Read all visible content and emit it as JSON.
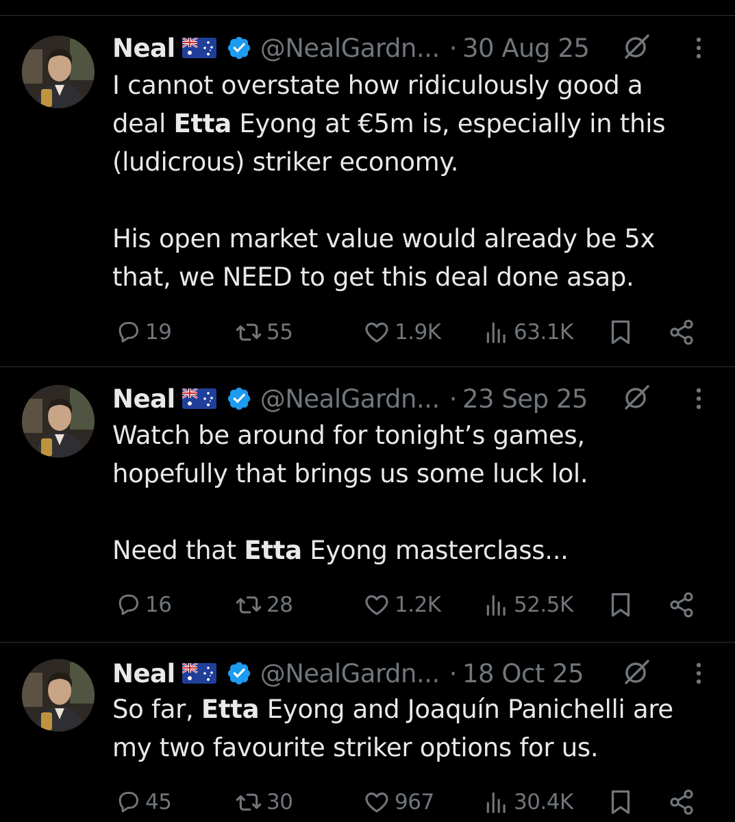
{
  "tweets": [
    {
      "name": "Neal",
      "handle": "@NealGardn...",
      "dot": "·",
      "date": "30 Aug 25",
      "body": [
        [
          {
            "t": "I cannot overstate how ridiculously good a"
          }
        ],
        [
          {
            "t": "deal "
          },
          {
            "t": "Etta",
            "b": true
          },
          {
            "t": " Eyong at €5m is, especially in this"
          }
        ],
        [
          {
            "t": "(ludicrous) striker economy."
          }
        ],
        [],
        [
          {
            "t": "His open market value would already be 5x"
          }
        ],
        [
          {
            "t": "that, we NEED to get this deal done asap."
          }
        ]
      ],
      "replies": "19",
      "reposts": "55",
      "likes": "1.9K",
      "views": "63.1K"
    },
    {
      "name": "Neal",
      "handle": "@NealGardn...",
      "dot": "·",
      "date": "23 Sep 25",
      "body": [
        [
          {
            "t": "Watch be around for tonight’s games,"
          }
        ],
        [
          {
            "t": "hopefully that brings us some luck lol."
          }
        ],
        [],
        [
          {
            "t": "Need that "
          },
          {
            "t": "Etta",
            "b": true
          },
          {
            "t": " Eyong masterclass..."
          }
        ]
      ],
      "replies": "16",
      "reposts": "28",
      "likes": "1.2K",
      "views": "52.5K"
    },
    {
      "name": "Neal",
      "handle": "@NealGardn...",
      "dot": "·",
      "date": "18 Oct 25",
      "body": [
        [
          {
            "t": "So far, "
          },
          {
            "t": "Etta",
            "b": true
          },
          {
            "t": " Eyong and Joaquín Panichelli are"
          }
        ],
        [
          {
            "t": "my two favourite striker options for us."
          }
        ]
      ],
      "replies": "45",
      "reposts": "30",
      "likes": "967",
      "views": "30.4K"
    }
  ],
  "icons": {
    "flag": "australia-flag-icon",
    "verified": "verified-badge-icon",
    "grok": "grok-icon",
    "more": "more-options-icon",
    "reply": "reply-icon",
    "repost": "repost-icon",
    "like": "heart-icon",
    "views": "views-icon",
    "bookmark": "bookmark-icon",
    "share": "share-icon"
  },
  "colors": {
    "background": "#000000",
    "text": "#e7e9ea",
    "secondary": "#71767b",
    "divider": "#2f3336",
    "verified": "#1d9bf0"
  }
}
